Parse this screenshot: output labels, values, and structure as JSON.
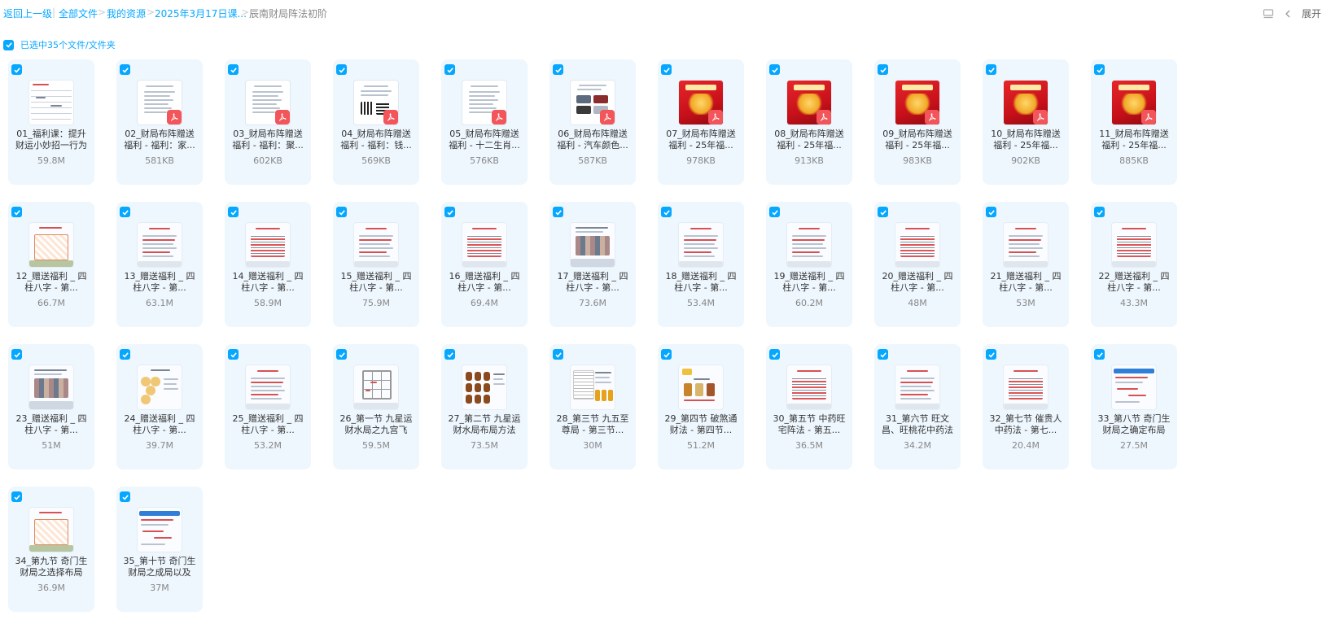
{
  "breadcrumb": {
    "back": "返回上一级",
    "items": [
      "全部文件",
      "我的资源",
      "2025年3月17日课...",
      "辰南财局阵法初阶"
    ]
  },
  "toolbar": {
    "expand_label": "展开"
  },
  "selection": {
    "text": "已选中35个文件/文件夹",
    "all_checked": true
  },
  "files": [
    {
      "name": "01_福利课：提升财运小妙招一行为",
      "size": "59.8M",
      "thumb": "video-grid"
    },
    {
      "name": "02_财局布阵赠送福利 - 福利：家...",
      "size": "581KB",
      "thumb": "pdf-doc"
    },
    {
      "name": "03_财局布阵赠送福利 - 福利：聚...",
      "size": "602KB",
      "thumb": "pdf-doc"
    },
    {
      "name": "04_财局布阵赠送福利 - 福利：钱...",
      "size": "569KB",
      "thumb": "pdf-qr"
    },
    {
      "name": "05_财局布阵赠送福利 - 十二生肖...",
      "size": "576KB",
      "thumb": "pdf-doc"
    },
    {
      "name": "06_财局布阵赠送福利 - 汽车颜色...",
      "size": "587KB",
      "thumb": "pdf-car"
    },
    {
      "name": "07_财局布阵赠送福利 - 25年福...",
      "size": "978KB",
      "thumb": "pdf-red"
    },
    {
      "name": "08_财局布阵赠送福利 - 25年福...",
      "size": "913KB",
      "thumb": "pdf-red"
    },
    {
      "name": "09_财局布阵赠送福利 - 25年福...",
      "size": "983KB",
      "thumb": "pdf-red"
    },
    {
      "name": "10_财局布阵赠送福利 - 25年福...",
      "size": "902KB",
      "thumb": "pdf-red"
    },
    {
      "name": "11_财局布阵赠送福利 - 25年福...",
      "size": "885KB",
      "thumb": "pdf-red"
    },
    {
      "name": "12_赠送福利 _ 四柱八字 - 第...",
      "size": "66.7M",
      "thumb": "slide-chart"
    },
    {
      "name": "13_赠送福利 _ 四柱八字 - 第...",
      "size": "63.1M",
      "thumb": "slide-text"
    },
    {
      "name": "14_赠送福利 _ 四柱八字 - 第...",
      "size": "58.9M",
      "thumb": "slide-red"
    },
    {
      "name": "15_赠送福利 _ 四柱八字 - 第...",
      "size": "75.9M",
      "thumb": "slide-text"
    },
    {
      "name": "16_赠送福利 _ 四柱八字 - 第...",
      "size": "69.4M",
      "thumb": "slide-red"
    },
    {
      "name": "17_赠送福利 _ 四柱八字 - 第...",
      "size": "73.6M",
      "thumb": "slide-photo"
    },
    {
      "name": "18_赠送福利 _ 四柱八字 - 第...",
      "size": "53.4M",
      "thumb": "slide-text"
    },
    {
      "name": "19_赠送福利 _ 四柱八字 - 第...",
      "size": "60.2M",
      "thumb": "slide-text"
    },
    {
      "name": "20_赠送福利 _ 四柱八字 - 第...",
      "size": "48M",
      "thumb": "slide-red"
    },
    {
      "name": "21_赠送福利 _ 四柱八字 - 第...",
      "size": "53M",
      "thumb": "slide-text"
    },
    {
      "name": "22_赠送福利 _ 四柱八字 - 第...",
      "size": "43.3M",
      "thumb": "slide-red"
    },
    {
      "name": "23_赠送福利 _ 四柱八字 - 第...",
      "size": "51M",
      "thumb": "slide-photo"
    },
    {
      "name": "24_赠送福利 _ 四柱八字 - 第...",
      "size": "39.7M",
      "thumb": "slide-circles"
    },
    {
      "name": "25_赠送福利 _ 四柱八字 - 第...",
      "size": "53.2M",
      "thumb": "slide-text"
    },
    {
      "name": "26_第一节 九星运财水局之九宫飞",
      "size": "59.5M",
      "thumb": "slide-grid"
    },
    {
      "name": "27_第二节 九星运财水局布局方法",
      "size": "73.5M",
      "thumb": "slide-jars"
    },
    {
      "name": "28_第三节 九五至尊局 - 第三节...",
      "size": "30M",
      "thumb": "slide-book"
    },
    {
      "name": "29_第四节 破煞通财法 - 第四节...",
      "size": "51.2M",
      "thumb": "slide-items"
    },
    {
      "name": "30_第五节 中药旺宅阵法 - 第五...",
      "size": "36.5M",
      "thumb": "slide-red"
    },
    {
      "name": "31_第六节 旺文昌、旺桃花中药法",
      "size": "34.2M",
      "thumb": "slide-text"
    },
    {
      "name": "32_第七节 催贵人中药法 - 第七...",
      "size": "20.4M",
      "thumb": "slide-red"
    },
    {
      "name": "33_第八节 奇门生财局之确定布局",
      "size": "27.5M",
      "thumb": "slide-blue"
    },
    {
      "name": "34_第九节 奇门生财局之选择布局",
      "size": "36.9M",
      "thumb": "slide-chart"
    },
    {
      "name": "35_第十节 奇门生财局之成局以及",
      "size": "37M",
      "thumb": "slide-blue"
    }
  ],
  "colors": {
    "accent": "#06a7ff",
    "card_bg": "#eef7fe",
    "pdf_badge": "#f2555a"
  }
}
